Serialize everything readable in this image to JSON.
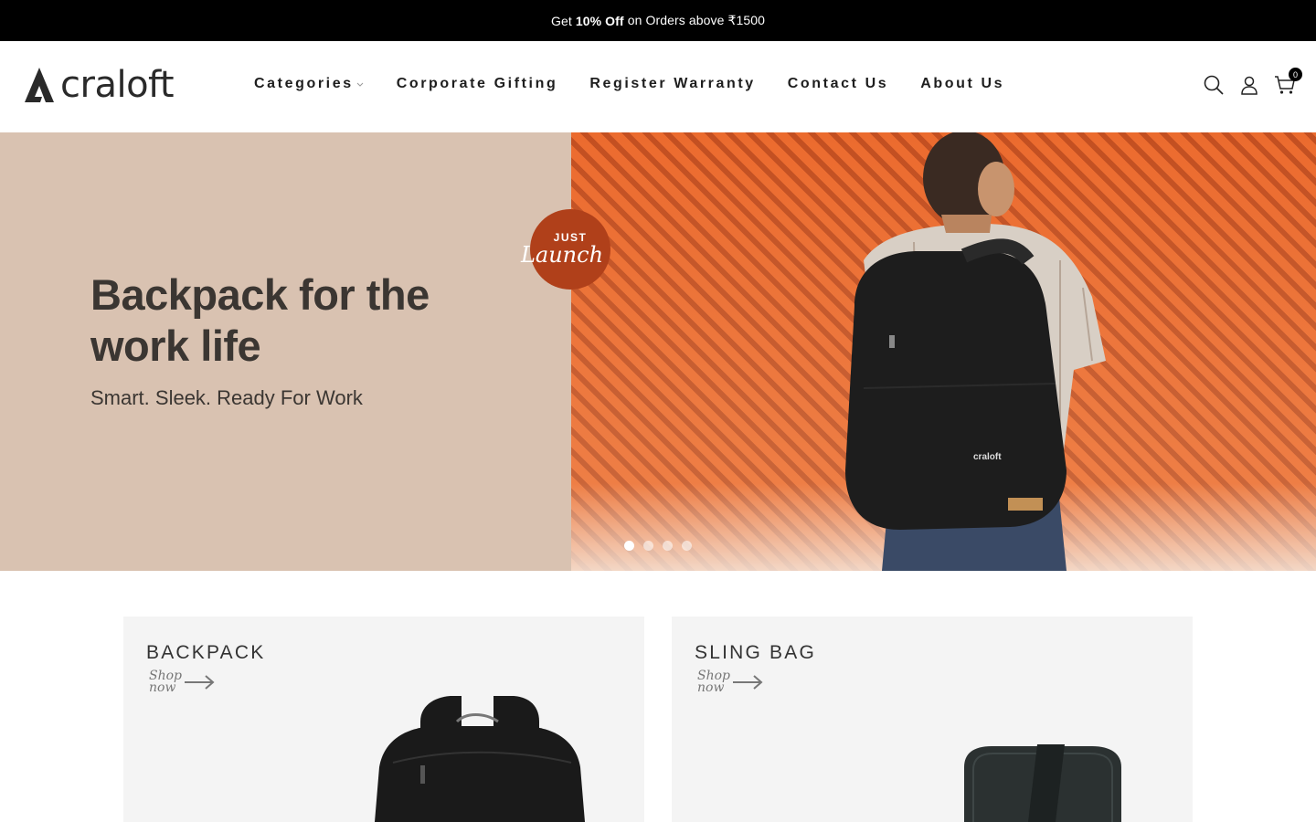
{
  "announcement": {
    "prefix": "Get",
    "highlight": "10% Off",
    "suffix": "on Orders above ₹1500"
  },
  "header": {
    "logo_text": "craloft",
    "nav": [
      {
        "label": "Categories",
        "has_dropdown": true
      },
      {
        "label": "Corporate Gifting"
      },
      {
        "label": "Register Warranty"
      },
      {
        "label": "Contact Us"
      },
      {
        "label": "About Us"
      }
    ],
    "icons": [
      "search-icon",
      "account-icon",
      "cart-icon"
    ],
    "cart_count": "0"
  },
  "hero": {
    "title": "Backpack for the work life",
    "subtitle": "Smart. Sleek. Ready For Work",
    "badge_top": "JUST",
    "badge_script": "Launch",
    "slides": 4,
    "active_slide": 1,
    "colors": {
      "left_bg": "#d9c2b1",
      "right_bg": "#e06a30",
      "badge": "#b0401a"
    }
  },
  "categories": [
    {
      "title": "BACKPACK",
      "cta": "Shop now"
    },
    {
      "title": "SLING BAG",
      "cta": "Shop now"
    }
  ]
}
